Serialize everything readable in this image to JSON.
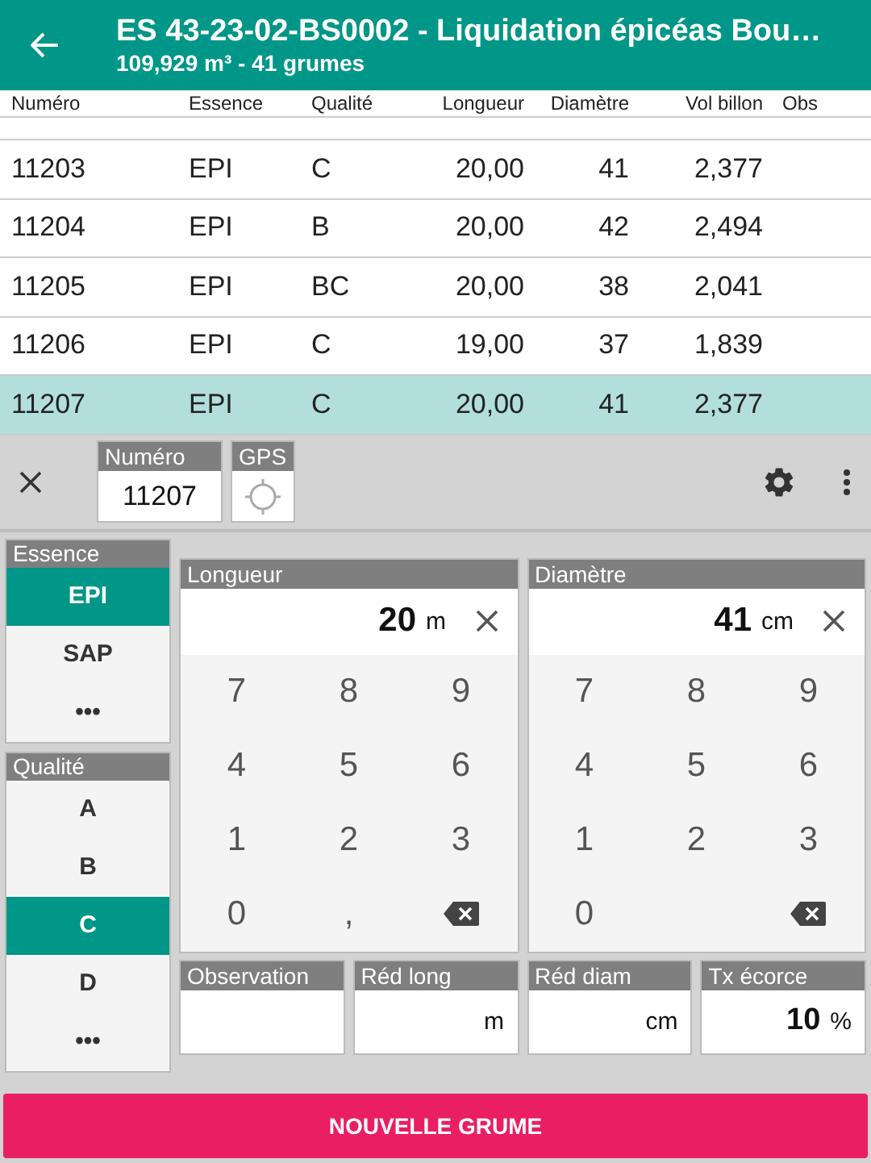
{
  "app_bar": {
    "title": "ES 43-23-02-BS0002 - Liquidation épicéas Bou…",
    "subtitle": "109,929 m³ - 41 grumes"
  },
  "table": {
    "columns": [
      "Numéro",
      "Essence",
      "Qualité",
      "Longueur",
      "Diamètre",
      "Vol billon",
      "Obs"
    ],
    "rows": [
      {
        "cells": [
          "11203",
          "EPI",
          "C",
          "20,00",
          "41",
          "2,377"
        ],
        "selected": false
      },
      {
        "cells": [
          "11204",
          "EPI",
          "B",
          "20,00",
          "42",
          "2,494"
        ],
        "selected": false
      },
      {
        "cells": [
          "11205",
          "EPI",
          "BC",
          "20,00",
          "38",
          "2,041"
        ],
        "selected": false
      },
      {
        "cells": [
          "11206",
          "EPI",
          "C",
          "19,00",
          "37",
          "1,839"
        ],
        "selected": false
      },
      {
        "cells": [
          "11207",
          "EPI",
          "C",
          "20,00",
          "41",
          "2,377"
        ],
        "selected": true
      }
    ]
  },
  "toolbar": {
    "numero": {
      "label": "Numéro",
      "value": "11207"
    },
    "gps": {
      "label": "GPS"
    }
  },
  "essence": {
    "label": "Essence",
    "options": [
      {
        "label": "EPI",
        "selected": true
      },
      {
        "label": "SAP",
        "selected": false
      },
      {
        "label": "•••",
        "selected": false
      }
    ]
  },
  "qualite": {
    "label": "Qualité",
    "options": [
      {
        "label": "A",
        "selected": false
      },
      {
        "label": "B",
        "selected": false
      },
      {
        "label": "C",
        "selected": true
      },
      {
        "label": "D",
        "selected": false
      },
      {
        "label": "•••",
        "selected": false
      }
    ]
  },
  "keypads": [
    {
      "label": "Longueur",
      "value": "20",
      "unit": "m",
      "keys": [
        {
          "kind": "digit",
          "label": "7"
        },
        {
          "kind": "digit",
          "label": "8"
        },
        {
          "kind": "digit",
          "label": "9"
        },
        {
          "kind": "digit",
          "label": "4"
        },
        {
          "kind": "digit",
          "label": "5"
        },
        {
          "kind": "digit",
          "label": "6"
        },
        {
          "kind": "digit",
          "label": "1"
        },
        {
          "kind": "digit",
          "label": "2"
        },
        {
          "kind": "digit",
          "label": "3"
        },
        {
          "kind": "digit",
          "label": "0"
        },
        {
          "kind": "digit",
          "label": ","
        },
        {
          "kind": "backspace"
        }
      ]
    },
    {
      "label": "Diamètre",
      "value": "41",
      "unit": "cm",
      "keys": [
        {
          "kind": "digit",
          "label": "7"
        },
        {
          "kind": "digit",
          "label": "8"
        },
        {
          "kind": "digit",
          "label": "9"
        },
        {
          "kind": "digit",
          "label": "4"
        },
        {
          "kind": "digit",
          "label": "5"
        },
        {
          "kind": "digit",
          "label": "6"
        },
        {
          "kind": "digit",
          "label": "1"
        },
        {
          "kind": "digit",
          "label": "2"
        },
        {
          "kind": "digit",
          "label": "3"
        },
        {
          "kind": "digit",
          "label": "0"
        },
        {
          "kind": "blank"
        },
        {
          "kind": "backspace"
        }
      ]
    }
  ],
  "fields": [
    {
      "label": "Observation"
    },
    {
      "label": "Réd long",
      "unit": "m"
    },
    {
      "label": "Réd diam",
      "unit": "cm"
    },
    {
      "label": "Tx écorce",
      "value": "10",
      "unit": "%"
    }
  ],
  "button": "NOUVELLE GRUME"
}
